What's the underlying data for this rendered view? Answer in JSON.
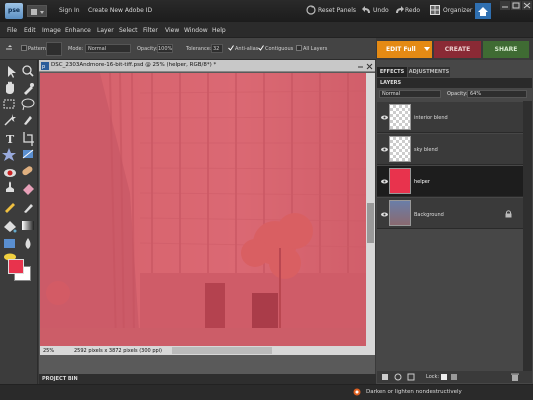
{
  "app": {
    "logo_text": "pse"
  },
  "topbar": {
    "sign_in": "Sign In",
    "create_id": "Create New Adobe ID",
    "reset_panels": "Reset Panels",
    "undo": "Undo",
    "redo": "Redo",
    "organizer": "Organizer"
  },
  "menu": [
    "File",
    "Edit",
    "Image",
    "Enhance",
    "Layer",
    "Select",
    "Filter",
    "View",
    "Window",
    "Help"
  ],
  "options": {
    "pattern_label": "Pattern",
    "mode_label": "Mode:",
    "mode_value": "Normal",
    "opacity_label": "Opacity:",
    "opacity_value": "100%",
    "tolerance_label": "Tolerance:",
    "tolerance_value": "32",
    "antialias_label": "Anti-alias",
    "contiguous_label": "Contiguous",
    "all_layers_label": "All Layers"
  },
  "modes": {
    "edit": "EDIT Full",
    "create": "CREATE",
    "share": "SHARE"
  },
  "document": {
    "title": "DSC_2303Andmore-16-bit-tiff.psd @ 25% (helper, RGB/8*) *",
    "zoom": "25%",
    "dimensions": "2592 pixels x 3872 pixels (300 ppi)"
  },
  "colors": {
    "foreground": "#e8334d",
    "background": "#ffffff",
    "overlay": "#e8475a"
  },
  "project_bin": {
    "label": "PROJECT BIN"
  },
  "panel": {
    "tabs": [
      "EFFECTS",
      "ADJUSTMENTS"
    ],
    "layers_title": "LAYERS",
    "blend_mode": "Normal",
    "opacity_label": "Opacity:",
    "opacity_value": "64%",
    "layers": [
      {
        "name": "interior blend"
      },
      {
        "name": "sky blend"
      },
      {
        "name": "helper"
      },
      {
        "name": "Background"
      }
    ],
    "lock_label": "Lock:"
  },
  "hint": "Darken or lighten nondestructively"
}
